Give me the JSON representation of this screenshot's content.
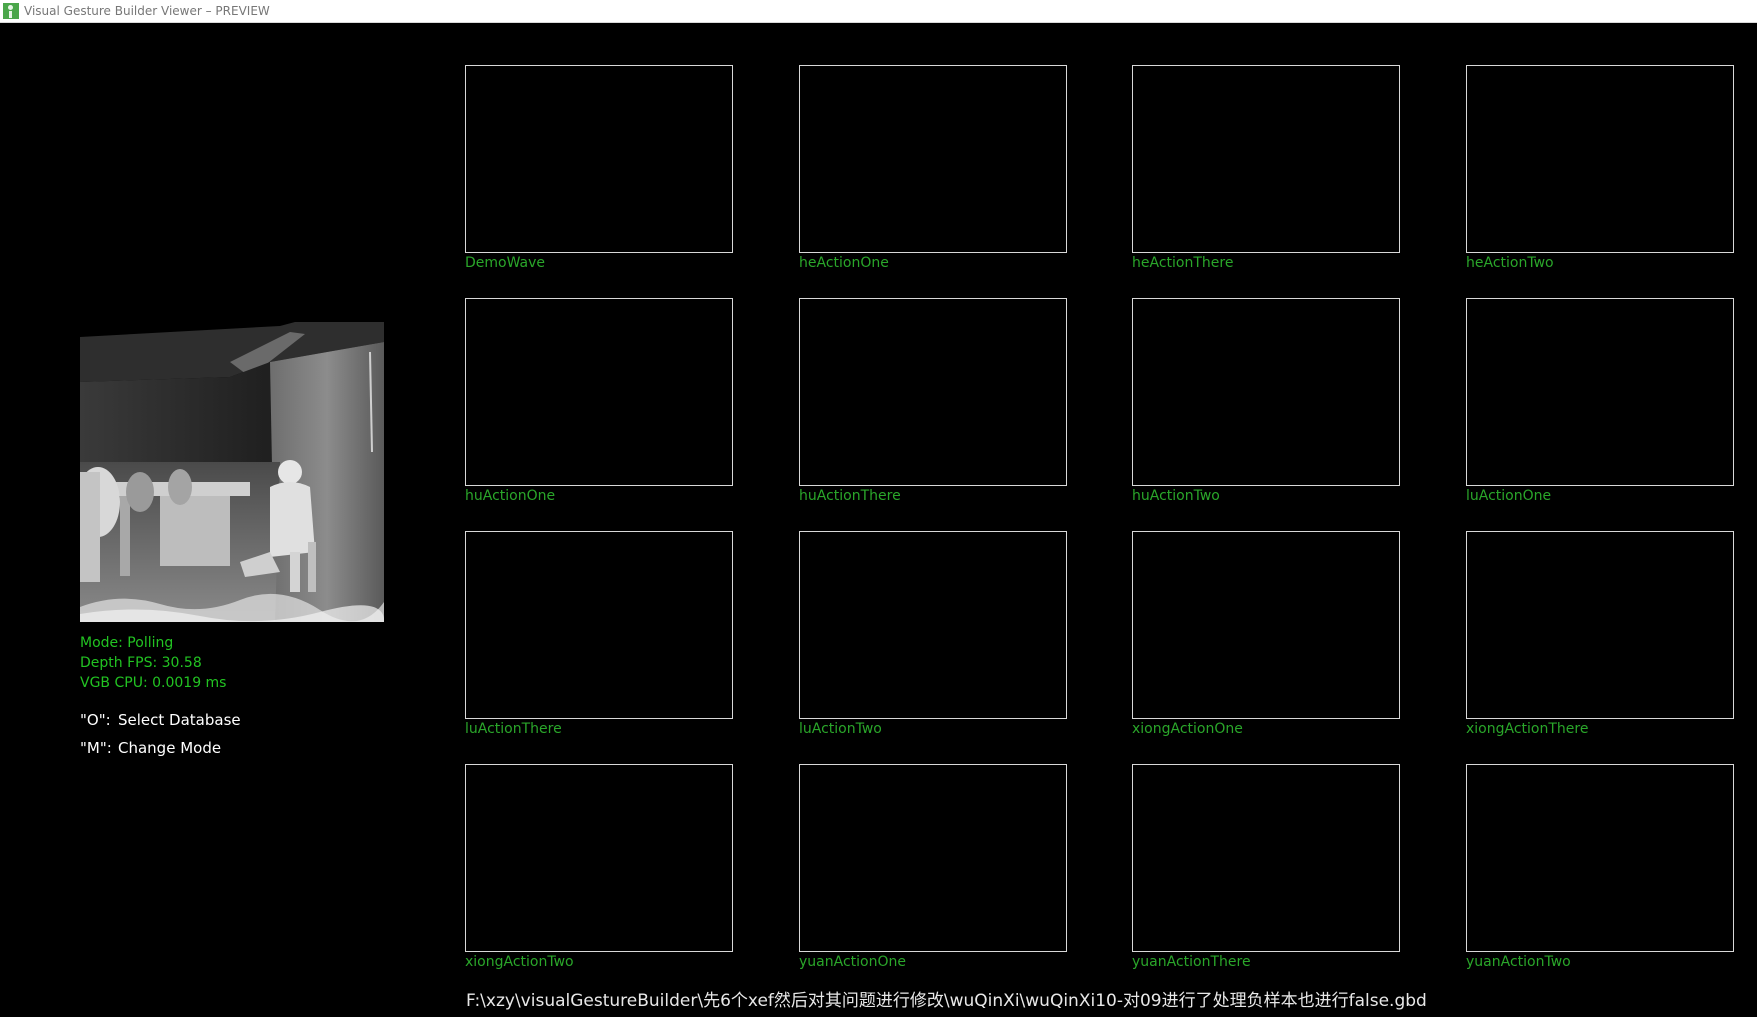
{
  "window": {
    "title": "Visual Gesture Builder Viewer – PREVIEW"
  },
  "status": {
    "mode": "Mode: Polling",
    "depth_fps": "Depth FPS: 30.58",
    "vgb_cpu": "VGB CPU: 0.0019 ms"
  },
  "help": [
    {
      "key": "\"O\":",
      "action": "Select Database"
    },
    {
      "key": "\"M\":",
      "action": "Change Mode"
    }
  ],
  "gestures": [
    {
      "label": "DemoWave"
    },
    {
      "label": "heActionOne"
    },
    {
      "label": "heActionThere"
    },
    {
      "label": "heActionTwo"
    },
    {
      "label": "huActionOne"
    },
    {
      "label": "huActionThere"
    },
    {
      "label": "huActionTwo"
    },
    {
      "label": "luActionOne"
    },
    {
      "label": "luActionThere"
    },
    {
      "label": "luActionTwo"
    },
    {
      "label": "xiongActionOne"
    },
    {
      "label": "xiongActionThere"
    },
    {
      "label": "xiongActionTwo"
    },
    {
      "label": "yuanActionOne"
    },
    {
      "label": "yuanActionThere"
    },
    {
      "label": "yuanActionTwo"
    }
  ],
  "database_path": "F:\\xzy\\visualGestureBuilder\\先6个xef然后对其问题进行修改\\wuQinXi\\wuQinXi10-对09进行了处理负样本也进行false.gbd",
  "colors": {
    "background": "#000000",
    "status_green": "#22c322",
    "label_green": "#2aa62a",
    "tile_border": "#d8d8d8"
  }
}
